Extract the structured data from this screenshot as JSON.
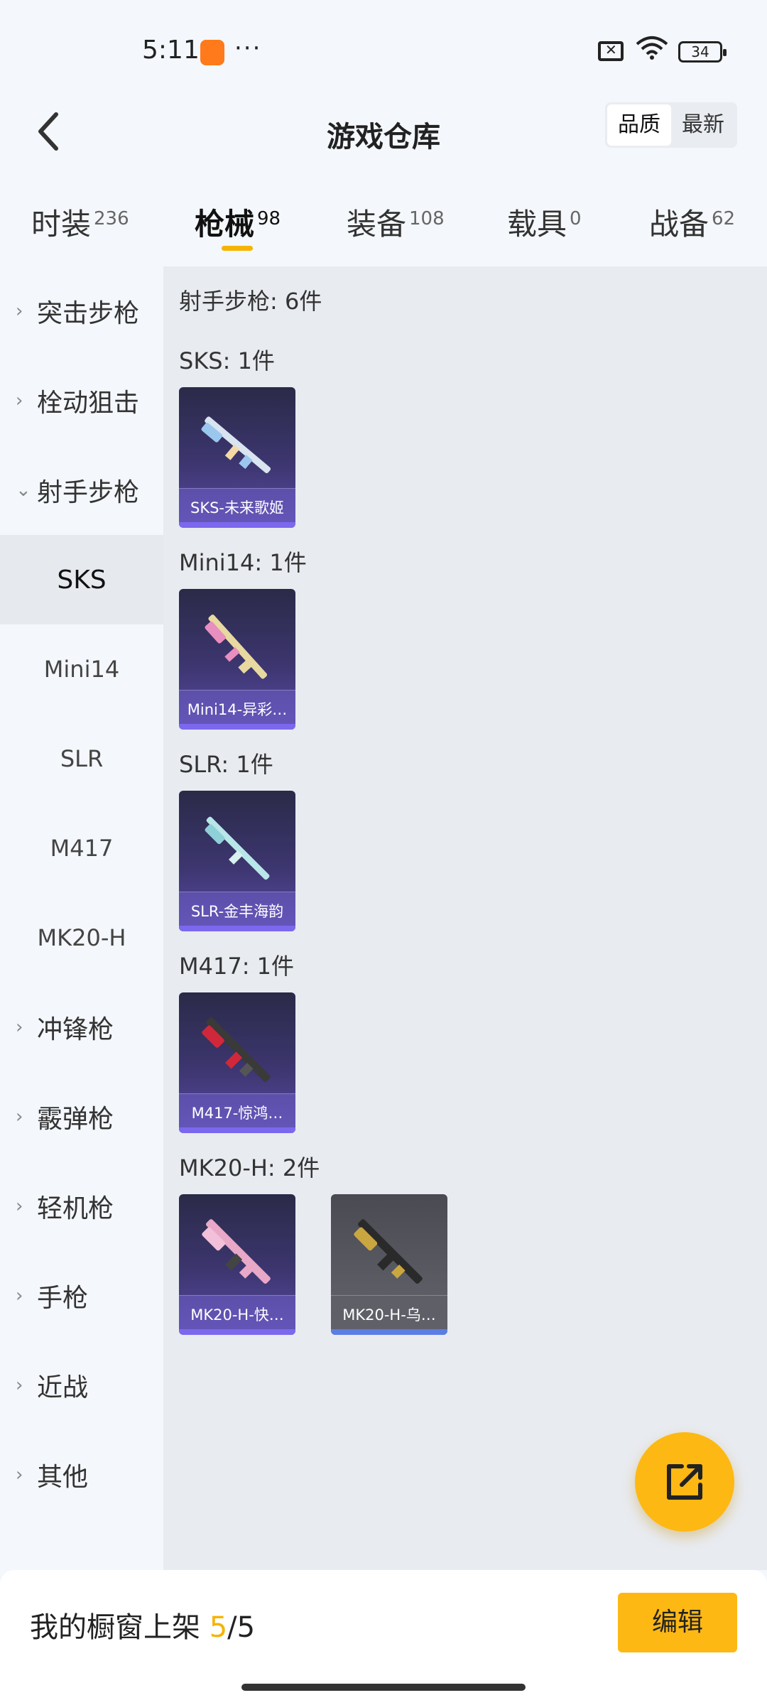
{
  "status_bar": {
    "time": "5:11",
    "dots": "···",
    "battery": "34"
  },
  "header": {
    "title": "游戏仓库",
    "sort_options": [
      "品质",
      "最新"
    ]
  },
  "tabs": [
    {
      "label": "时装",
      "count": "236"
    },
    {
      "label": "枪械",
      "count": "98"
    },
    {
      "label": "装备",
      "count": "108"
    },
    {
      "label": "载具",
      "count": "0"
    },
    {
      "label": "战备",
      "count": "62"
    }
  ],
  "sidebar": {
    "items": [
      {
        "label": "突击步枪",
        "type": "category"
      },
      {
        "label": "栓动狙击",
        "type": "category"
      },
      {
        "label": "射手步枪",
        "type": "category-open"
      },
      {
        "label": "SKS",
        "type": "sub"
      },
      {
        "label": "Mini14",
        "type": "sub"
      },
      {
        "label": "SLR",
        "type": "sub"
      },
      {
        "label": "M417",
        "type": "sub"
      },
      {
        "label": "MK20-H",
        "type": "sub"
      },
      {
        "label": "冲锋枪",
        "type": "category"
      },
      {
        "label": "霰弹枪",
        "type": "category"
      },
      {
        "label": "轻机枪",
        "type": "category"
      },
      {
        "label": "手枪",
        "type": "category"
      },
      {
        "label": "近战",
        "type": "category"
      },
      {
        "label": "其他",
        "type": "category"
      }
    ]
  },
  "content": {
    "section_title": "射手步枪: 6件",
    "groups": [
      {
        "title": "SKS: 1件",
        "items": [
          {
            "name": "SKS-未来歌姬"
          }
        ]
      },
      {
        "title": "Mini14: 1件",
        "items": [
          {
            "name": "Mini14-异彩…"
          }
        ]
      },
      {
        "title": "SLR: 1件",
        "items": [
          {
            "name": "SLR-金丰海韵"
          }
        ]
      },
      {
        "title": "M417: 1件",
        "items": [
          {
            "name": "M417-惊鸿…"
          }
        ]
      },
      {
        "title": "MK20-H: 2件",
        "items": [
          {
            "name": "MK20-H-快…"
          },
          {
            "name": "MK20-H-乌…"
          }
        ]
      }
    ]
  },
  "bottom_bar": {
    "label": "我的橱窗上架 ",
    "current": "5",
    "total": "/5",
    "edit_label": "编辑"
  },
  "colors": {
    "accent": "#fdb813",
    "card_purple": "#5b4ba8",
    "card_grey": "#5a5a62"
  }
}
